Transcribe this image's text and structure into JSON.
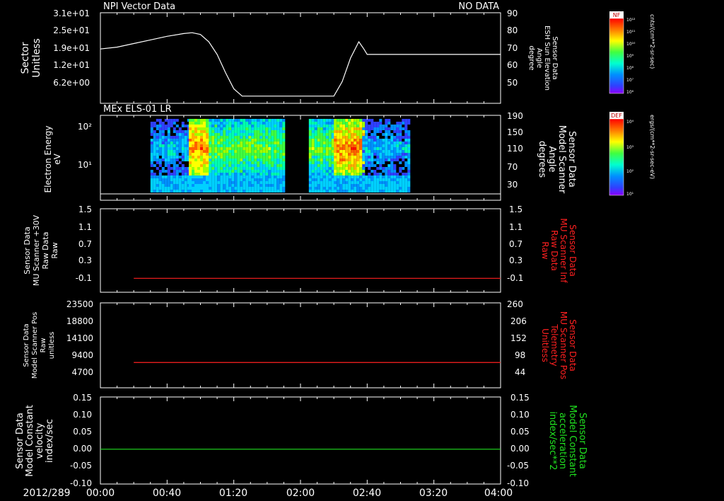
{
  "date_label": "2012/289",
  "x_ticks": [
    "00:00",
    "00:40",
    "01:20",
    "02:00",
    "02:40",
    "03:20",
    "04:00"
  ],
  "panel1": {
    "title": "NPI Vector Data",
    "status": "NO DATA",
    "left_ylabel": [
      "Sector",
      "Unitless"
    ],
    "left_ticks": [
      "3.1e+01",
      "2.5e+01",
      "1.9e+01",
      "1.2e+01",
      "6.2e+00"
    ],
    "right_ylabel": [
      "Sensor Data",
      "ESH Sun Elevation",
      "Angle",
      "degree"
    ],
    "right_ticks": [
      "90",
      "80",
      "70",
      "60",
      "50"
    ],
    "colorbar_label": "NF",
    "colorbar_units": "cnts/(cm**2-sr-sec)",
    "colorbar_ticks": [
      "10¹²",
      "10¹¹",
      "10¹⁰",
      "10⁹",
      "10⁸",
      "10⁷",
      "10⁶"
    ]
  },
  "panel2": {
    "title": "MEx ELS-01 LR",
    "left_ylabel": [
      "Electron Energy",
      "eV"
    ],
    "left_ticks": [
      "10²",
      "10¹"
    ],
    "right_ylabel": [
      "Sensor Data",
      "Model Scanner",
      "Angle",
      "degrees"
    ],
    "right_ticks": [
      "190",
      "150",
      "110",
      "70",
      "30"
    ],
    "colorbar_label": "DEF",
    "colorbar_units": "ergs/(cm**2-sr-sec-eV)",
    "colorbar_ticks": [
      "10⁴",
      "10³",
      "10²",
      "10¹"
    ]
  },
  "panel3": {
    "left_ylabel": [
      "Sensor Data",
      "MU Scanner +30V",
      "Raw Data",
      "Raw"
    ],
    "left_ticks": [
      "1.5",
      "1.1",
      "0.7",
      "0.3",
      "-0.1"
    ],
    "right_ylabel": [
      "Sensor Data",
      "MU Scanner Inf",
      "Raw Data",
      "Raw"
    ],
    "right_ticks": [
      "1.5",
      "1.1",
      "0.7",
      "0.3",
      "-0.1"
    ]
  },
  "panel4": {
    "left_ylabel": [
      "Sensor Data",
      "Model Scanner Pos",
      "Raw",
      "unitless"
    ],
    "left_ticks": [
      "23500",
      "18800",
      "14100",
      "9400",
      "4700"
    ],
    "right_ylabel": [
      "Sensor Data",
      "MU Scanner Pos",
      "Telemetry",
      "Unitless"
    ],
    "right_ticks": [
      "260",
      "206",
      "152",
      "98",
      "44"
    ]
  },
  "panel5": {
    "left_ylabel": [
      "Sensor Data",
      "Model Constant",
      "velocity",
      "index/sec"
    ],
    "left_ticks": [
      "0.15",
      "0.10",
      "0.05",
      "0.00",
      "-0.05",
      "-0.10"
    ],
    "right_ylabel": [
      "Sensor Data",
      "Model Constant",
      "acceleration",
      "index/sec**2"
    ],
    "right_ticks": [
      "0.15",
      "0.10",
      "0.05",
      "0.00",
      "-0.05",
      "-0.10"
    ]
  },
  "colors": {
    "line_white": "#ffffff",
    "line_red": "#ff2020",
    "line_green": "#20e020",
    "label_red": "#ff2020",
    "label_green": "#20e020"
  },
  "chart_data": [
    {
      "type": "line",
      "title": "NPI Vector Data",
      "x_range": [
        "00:00",
        "04:00"
      ],
      "y_axis": "Sensor Data ESH Sun Elevation Angle (degree)",
      "ylim": [
        40,
        90
      ],
      "x_minutes": [
        0,
        10,
        20,
        30,
        40,
        50,
        55,
        60,
        65,
        70,
        75,
        80,
        85,
        90,
        100,
        110,
        120,
        130,
        140,
        145,
        150,
        155,
        158,
        160,
        165,
        240
      ],
      "y_values": [
        70,
        71,
        73,
        75,
        77,
        78.5,
        79,
        78,
        74,
        67,
        57,
        48,
        44,
        44,
        44,
        44,
        44,
        44,
        44,
        52,
        65,
        74,
        70,
        67,
        67,
        67
      ]
    },
    {
      "type": "heatmap",
      "title": "MEx ELS-01 LR",
      "y_axis": "Electron Energy (eV)",
      "bursts": [
        {
          "start": "00:30",
          "end": "00:53",
          "level": "low"
        },
        {
          "start": "00:53",
          "end": "01:05",
          "level": "high"
        },
        {
          "start": "01:05",
          "end": "01:50",
          "level": "medium"
        },
        {
          "start": "02:05",
          "end": "02:20",
          "level": "medium"
        },
        {
          "start": "02:20",
          "end": "02:37",
          "level": "high"
        },
        {
          "start": "02:37",
          "end": "03:05",
          "level": "low"
        }
      ],
      "gap": [
        "01:52",
        "02:00"
      ]
    },
    {
      "type": "line",
      "series": [
        {
          "name": "MU Scanner Inf Raw Data",
          "x_range": [
            "00:20",
            "04:00"
          ],
          "value": 0.0
        }
      ],
      "ylim": [
        -0.3,
        1.5
      ]
    },
    {
      "type": "line",
      "series": [
        {
          "name": "MU Scanner Pos Telemetry",
          "x_range": [
            "00:20",
            "04:00"
          ],
          "value": 7000
        }
      ],
      "ylim": [
        0,
        23500
      ]
    },
    {
      "type": "line",
      "series": [
        {
          "name": "Model Constant acceleration",
          "x_range": [
            "00:00",
            "04:00"
          ],
          "value": 0.0
        }
      ],
      "ylim": [
        -0.1,
        0.15
      ]
    }
  ]
}
